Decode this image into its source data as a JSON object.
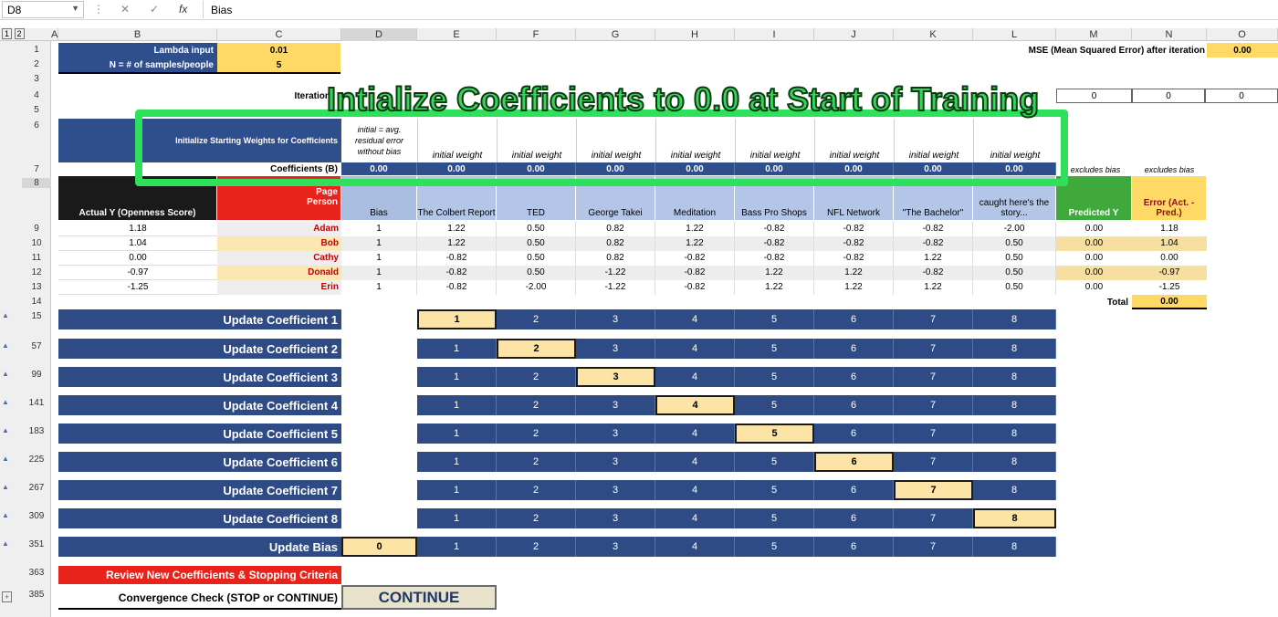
{
  "formula_bar": {
    "name_box": "D8",
    "fx": "fx",
    "value": "Bias"
  },
  "columns": [
    "A",
    "B",
    "C",
    "D",
    "E",
    "F",
    "G",
    "H",
    "I",
    "J",
    "K",
    "L",
    "M",
    "N",
    "O"
  ],
  "rows": [
    "1",
    "2",
    "3",
    "4",
    "5",
    "6",
    "7",
    "8",
    "9",
    "10",
    "11",
    "12",
    "13",
    "14",
    "15",
    "57",
    "99",
    "141",
    "183",
    "225",
    "267",
    "309",
    "351",
    "363",
    "385"
  ],
  "params": {
    "lambda_label": "Lambda input",
    "lambda_value": "0.01",
    "n_label": "N = # of samples/people",
    "n_value": "5",
    "iteration_label": "Iteration",
    "mse_label": "MSE (Mean Squared Error) after iteration",
    "mse_value": "0.00",
    "iteration_vals": [
      "0",
      "0",
      "0"
    ]
  },
  "overlay_title": "Intialize Coefficients to 0.0 at Start of Training",
  "init_block": {
    "label": "Initialize Starting Weights for Coefficients",
    "bias_note": "initial = avg. residual error without bias",
    "weight_note": "initial weight",
    "coef_label": "Coefficients (B)",
    "coef_values": [
      "0.00",
      "0.00",
      "0.00",
      "0.00",
      "0.00",
      "0.00",
      "0.00",
      "0.00",
      "0.00"
    ],
    "excludes_bias": "excludes bias"
  },
  "table": {
    "actual_header": "Actual  Y (Openness Score)",
    "page_header": "Page",
    "person_header": "Person",
    "headers": [
      "Bias",
      "The Colbert Report",
      "TED",
      "George Takei",
      "Meditation",
      "Bass Pro Shops",
      "NFL Network",
      "\"The Bachelor\"",
      "caught here's the story..."
    ],
    "predicted_header": "Predicted  Y",
    "error_header": "Error (Act. - Pred.)",
    "rows": [
      {
        "actual": "1.18",
        "name": "Adam",
        "vals": [
          "1",
          "1.22",
          "0.50",
          "0.82",
          "1.22",
          "-0.82",
          "-0.82",
          "-0.82",
          "-2.00"
        ],
        "pred": "0.00",
        "err": "1.18"
      },
      {
        "actual": "1.04",
        "name": "Bob",
        "vals": [
          "1",
          "1.22",
          "0.50",
          "0.82",
          "1.22",
          "-0.82",
          "-0.82",
          "-0.82",
          "0.50"
        ],
        "pred": "0.00",
        "err": "1.04"
      },
      {
        "actual": "0.00",
        "name": "Cathy",
        "vals": [
          "1",
          "-0.82",
          "0.50",
          "0.82",
          "-0.82",
          "-0.82",
          "-0.82",
          "1.22",
          "0.50"
        ],
        "pred": "0.00",
        "err": "0.00"
      },
      {
        "actual": "-0.97",
        "name": "Donald",
        "vals": [
          "1",
          "-0.82",
          "0.50",
          "-1.22",
          "-0.82",
          "1.22",
          "1.22",
          "-0.82",
          "0.50"
        ],
        "pred": "0.00",
        "err": "-0.97"
      },
      {
        "actual": "-1.25",
        "name": "Erin",
        "vals": [
          "1",
          "-0.82",
          "-2.00",
          "-1.22",
          "-0.82",
          "1.22",
          "1.22",
          "1.22",
          "0.50"
        ],
        "pred": "0.00",
        "err": "-1.25"
      }
    ],
    "total_label": "Total",
    "total_value": "0.00"
  },
  "updates": [
    {
      "label": "Update Coefficient 1",
      "hl": 1
    },
    {
      "label": "Update Coefficient 2",
      "hl": 2
    },
    {
      "label": "Update Coefficient 3",
      "hl": 3
    },
    {
      "label": "Update Coefficient 4",
      "hl": 4
    },
    {
      "label": "Update Coefficient 5",
      "hl": 5
    },
    {
      "label": "Update Coefficient 6",
      "hl": 6
    },
    {
      "label": "Update Coefficient 7",
      "hl": 7
    },
    {
      "label": "Update Coefficient 8",
      "hl": 8
    }
  ],
  "update_numbers": [
    "1",
    "2",
    "3",
    "4",
    "5",
    "6",
    "7",
    "8"
  ],
  "update_bias": {
    "label": "Update Bias",
    "value": "0"
  },
  "review_label": "Review New Coefficients & Stopping Criteria",
  "convergence_label": "Convergence Check (STOP or CONTINUE)",
  "convergence_value": "CONTINUE",
  "outline_levels": [
    "1",
    "2"
  ],
  "expand_symbol": "+"
}
